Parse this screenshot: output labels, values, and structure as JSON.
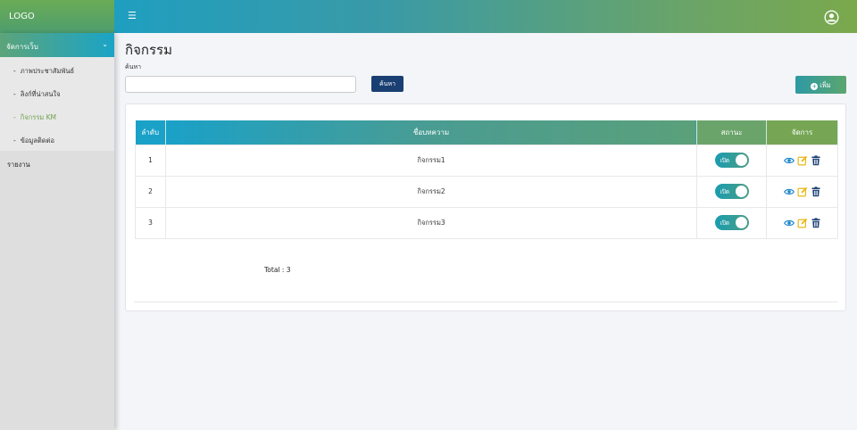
{
  "header": {
    "logo": "LOGO",
    "menu_icon": "☰",
    "user_icon": "user-circle-icon"
  },
  "sidebar": {
    "group": {
      "label": "จัดการเว็บ",
      "expanded": true
    },
    "items": [
      {
        "label": "ภาพประชาสัมพันธ์",
        "active": false
      },
      {
        "label": "ลิงก์ที่น่าสนใจ",
        "active": false
      },
      {
        "label": "กิจกรรม KM",
        "active": true
      },
      {
        "label": "ข้อมูลติดต่อ",
        "active": false
      }
    ],
    "report": "รายงาน",
    "active_color": "#6ea24e"
  },
  "main": {
    "title": "กิจกรรม",
    "search": {
      "label": "ค้นหา",
      "value": "",
      "placeholder": "",
      "button": "ค้นหา"
    },
    "add_button": "เพิ่ม",
    "table": {
      "headers": [
        "ลำดับ",
        "ชื่อบทความ",
        "สถานะ",
        "จัดการ"
      ],
      "rows": [
        {
          "index": "1",
          "title": "กิจกรรม1",
          "status": "เปิด",
          "status_on": true
        },
        {
          "index": "2",
          "title": "กิจกรรม2",
          "status": "เปิด",
          "status_on": true
        },
        {
          "index": "3",
          "title": "กิจกรรม3",
          "status": "เปิด",
          "status_on": true
        }
      ]
    },
    "total": "Total : 3"
  },
  "colors": {
    "navy_button": "#1a3f73",
    "view_icon": "#1a85c8",
    "edit_icon": "#e8b818",
    "delete_icon": "#1a3f73"
  }
}
